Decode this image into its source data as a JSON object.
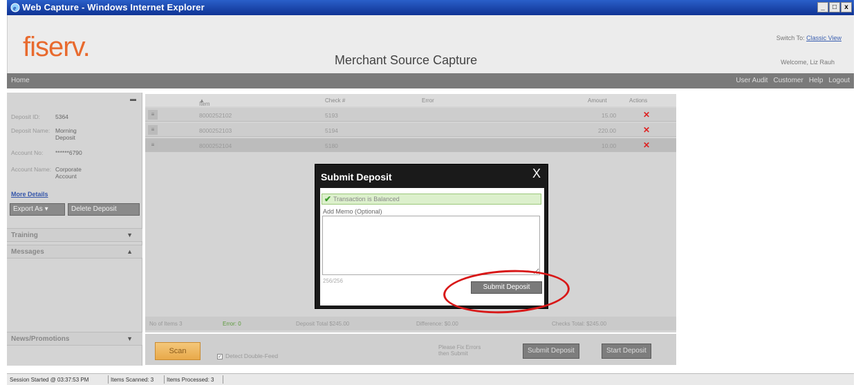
{
  "window": {
    "title": "Web Capture - Windows Internet Explorer",
    "controls": [
      "_",
      "□",
      "x"
    ]
  },
  "header": {
    "logo": "fiserv.",
    "app_title": "Merchant Source Capture",
    "switch_to_label": "Switch To:",
    "switch_to_link": "Classic View",
    "welcome": "Welcome, Liz Rauh"
  },
  "nav": {
    "home": "Home",
    "items": [
      "User Audit",
      "Customer",
      "Help",
      "Logout"
    ]
  },
  "sidebar": {
    "deposit_id_label": "Deposit ID:",
    "deposit_id": "5364",
    "deposit_name_label": "Deposit Name:",
    "deposit_name": "Morning Deposit",
    "account_no_label": "Account No:",
    "account_no": "******6790",
    "account_name_label": "Account Name:",
    "account_name": "Corporate Account",
    "more_details": "More Details",
    "export_as": "Export As",
    "delete_deposit": "Delete Deposit",
    "training": "Training",
    "messages": "Messages",
    "news": "News/Promotions"
  },
  "grid": {
    "columns": [
      "Item #",
      "Check #",
      "Error",
      "Amount",
      "Actions"
    ],
    "rows": [
      {
        "item": "8000252102",
        "check": "5193",
        "error": "",
        "amount": "15.00"
      },
      {
        "item": "8000252103",
        "check": "5194",
        "error": "",
        "amount": "220.00"
      },
      {
        "item": "8000252104",
        "check": "5180",
        "error": "",
        "amount": "10.00"
      }
    ]
  },
  "summary": {
    "num_items": "No of Items 3",
    "error": "Error: 0",
    "deposit_total": "Deposit Total $245.00",
    "difference": "Difference: $0.00",
    "checks_total": "Checks Total: $245.00"
  },
  "bottom": {
    "scan": "Scan",
    "detect_double_feed": "Detect Double-Feed",
    "fix_note": "Please Fix Errors then Submit",
    "submit_deposit": "Submit Deposit",
    "start_deposit": "Start Deposit"
  },
  "modal": {
    "title": "Submit Deposit",
    "close": "X",
    "balanced": "Transaction is Balanced",
    "memo_label": "Add Memo (Optional)",
    "memo_value": "",
    "char_count": "256/256",
    "submit": "Submit Deposit"
  },
  "status": {
    "session": "Session Started @ 03:37:53 PM",
    "scanned": "Items Scanned: 3",
    "processed": "Items Processed: 3"
  }
}
